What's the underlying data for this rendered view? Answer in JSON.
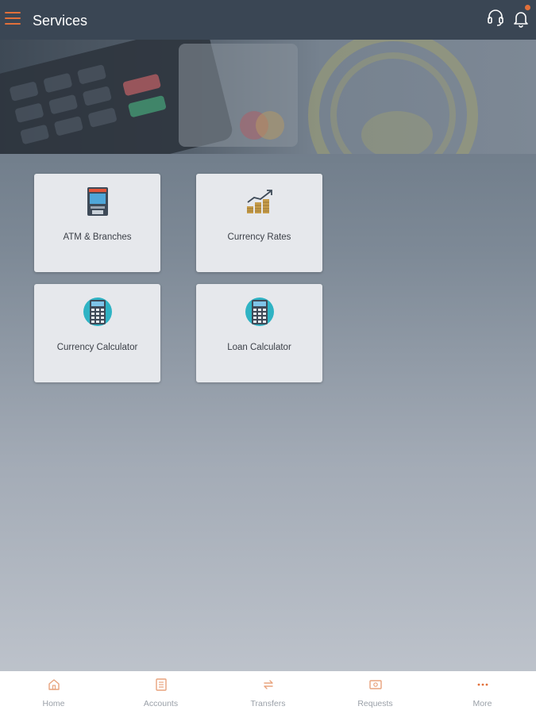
{
  "header": {
    "title": "Services"
  },
  "icons": {
    "menu": "hamburger-menu-icon",
    "support": "headset-icon",
    "notifications": "bell-icon"
  },
  "colors": {
    "accent": "#e2703a",
    "header_bg": "#3a4654"
  },
  "services": [
    {
      "label": "ATM & Branches",
      "icon": "atm-icon"
    },
    {
      "label": "Currency Rates",
      "icon": "chart-coins-icon"
    },
    {
      "label": "Currency Calculator",
      "icon": "calculator-icon"
    },
    {
      "label": "Loan Calculator",
      "icon": "calculator-icon"
    }
  ],
  "bottom_nav": [
    {
      "label": "Home",
      "icon": "home-icon"
    },
    {
      "label": "Accounts",
      "icon": "accounts-icon"
    },
    {
      "label": "Transfers",
      "icon": "transfer-icon"
    },
    {
      "label": "Requests",
      "icon": "requests-icon"
    },
    {
      "label": "More",
      "icon": "more-dots-icon"
    }
  ]
}
